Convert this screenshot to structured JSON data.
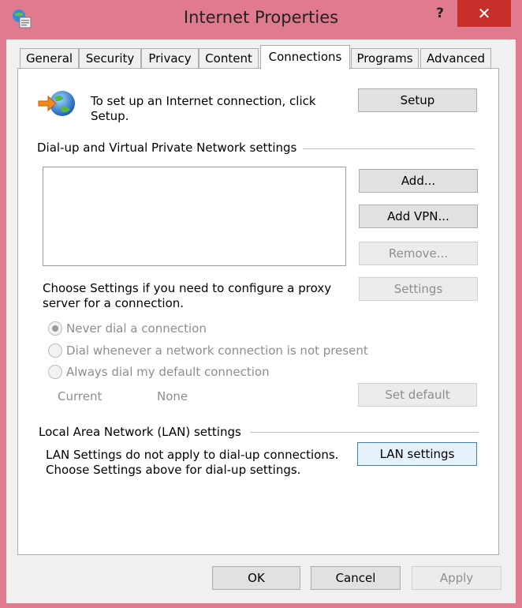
{
  "window": {
    "title": "Internet Properties",
    "help_glyph": "?",
    "close_glyph": "✕"
  },
  "tabs": [
    {
      "label": "General"
    },
    {
      "label": "Security"
    },
    {
      "label": "Privacy"
    },
    {
      "label": "Content"
    },
    {
      "label": "Connections",
      "active": true
    },
    {
      "label": "Programs"
    },
    {
      "label": "Advanced"
    }
  ],
  "setup": {
    "text_line1": "To set up an Internet connection, click",
    "text_line2": "Setup.",
    "button": "Setup"
  },
  "dialup": {
    "group_label": "Dial-up and Virtual Private Network settings",
    "add_button": "Add...",
    "add_vpn_button": "Add VPN...",
    "remove_button": "Remove...",
    "settings_button": "Settings",
    "proxy_text_line1": "Choose Settings if you need to configure a proxy",
    "proxy_text_line2": "server for a connection.",
    "radio_never": "Never dial a connection",
    "radio_whenever": "Dial whenever a network connection is not present",
    "radio_always": "Always dial my default connection",
    "current_label": "Current",
    "current_value": "None",
    "set_default_button": "Set default"
  },
  "lan": {
    "group_label": "Local Area Network (LAN) settings",
    "text_line1": "LAN Settings do not apply to dial-up connections.",
    "text_line2": "Choose Settings above for dial-up settings.",
    "button": "LAN settings"
  },
  "footer": {
    "ok": "OK",
    "cancel": "Cancel",
    "apply": "Apply"
  },
  "colors": {
    "frame": "#e07b8f",
    "close": "#c7302a",
    "disabled_text": "#8e8e8e"
  }
}
